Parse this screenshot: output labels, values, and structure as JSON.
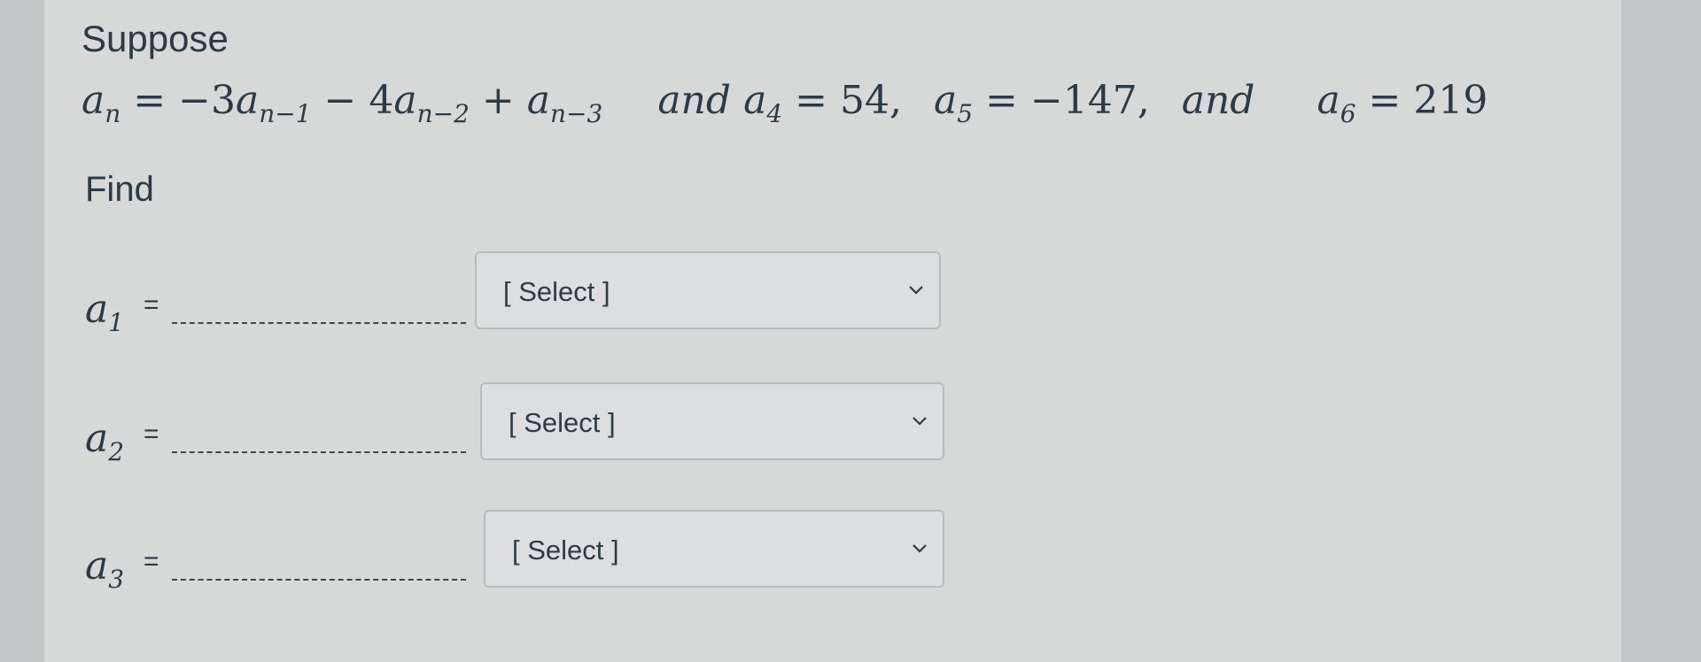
{
  "intro": "Suppose",
  "formula": {
    "an": "a",
    "an_sub": "n",
    "eq1": "= −3",
    "a1": "a",
    "a1_sub": "n−1",
    "minus": " − 4",
    "a2": "a",
    "a2_sub": "n−2",
    "plus": " + ",
    "a3": "a",
    "a3_sub": "n−3",
    "and1": "and",
    "a4": "a",
    "a4_sub": "4",
    "a4_val": " = 54,",
    "a5": "a",
    "a5_sub": "5",
    "a5_val": " = −147,",
    "and2": "and",
    "a6": "a",
    "a6_sub": "6",
    "a6_val": " = 219"
  },
  "find_label": "Find",
  "questions": [
    {
      "var": "a",
      "sub": "1",
      "eq": "=",
      "selected": "[ Select ]"
    },
    {
      "var": "a",
      "sub": "2",
      "eq": "=",
      "selected": "[ Select ]"
    },
    {
      "var": "a",
      "sub": "3",
      "eq": "=",
      "selected": "[ Select ]"
    }
  ],
  "colors": {
    "page_bg": "#c4c6c7",
    "card_bg": "#d7d9d9",
    "text": "#2b3a44",
    "select_border": "#b7bbbe"
  },
  "icons": {
    "dropdown": "chevron-down-icon"
  }
}
